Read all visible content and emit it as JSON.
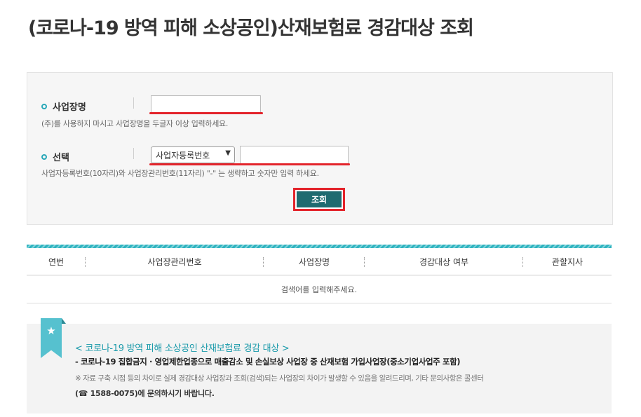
{
  "page": {
    "title": "(코로나-19 방역 피해 소상공인)산재보험료 경감대상 조회"
  },
  "search_form": {
    "business_name": {
      "label": "사업장명",
      "value": "",
      "hint": "(주)를 사용하지 마시고 사업장명을 두글자 이상 입력하세요."
    },
    "selection": {
      "label": "선택",
      "selected_option": "사업자등록번호",
      "value": "",
      "hint": "사업자등록번호(10자리)와 사업장관리번호(11자리) \"-\" 는 생략하고 숫자만 입력 하세요."
    },
    "search_button_label": "조회",
    "highlight_color": "#e3242b",
    "button_color": "#1e6b70"
  },
  "results_table": {
    "headers": [
      "연번",
      "사업장관리번호",
      "사업장명",
      "경감대상 여부",
      "관할지사"
    ],
    "empty_message": "검색어를 입력해주세요."
  },
  "notice": {
    "icon": "star-icon",
    "title": "< 코로나-19 방역 피해 소상공인 산재보험료 경감 대상 >",
    "line1": "- 코로나-19 집합금지 · 영업제한업종으로 매출감소 및 손실보상 사업장 중 산재보험 가입사업장(중소기업사업주 포함)",
    "line2": "※ 자료 구축 시점 등의 차이로 실제 경감대상 사업장과 조회(검색)되는 사업장의 차이가 발생할 수 있음을 알려드리며, 기타 문의사항은 콜센터",
    "line3": "(☎ 1588-0075)에 문의하시기 바랍니다.",
    "accent_color": "#1a9aaa"
  }
}
